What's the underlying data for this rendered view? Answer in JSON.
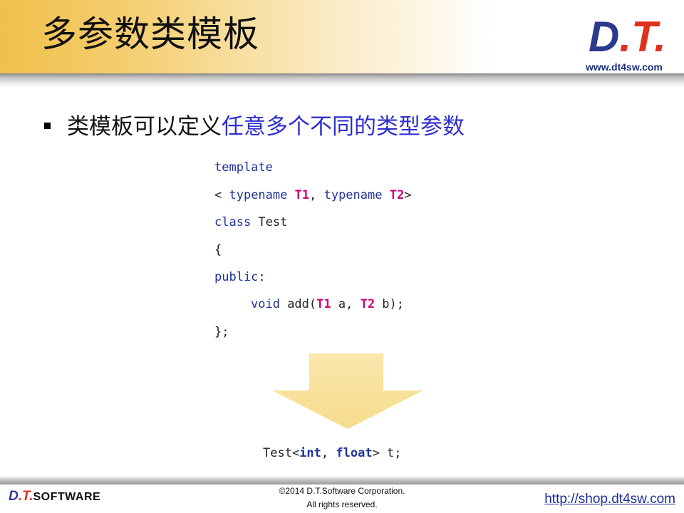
{
  "slide": {
    "title": "多参数类模板",
    "logo_prefix": "D",
    "logo_dot1": ".",
    "logo_t": "T",
    "logo_dot2": ".",
    "site_url": "www.dt4sw.com"
  },
  "bullet": {
    "text_plain": "类模板可以定义",
    "text_highlight": "任意多个不同的类型参数"
  },
  "code": {
    "line1": "template",
    "line2_a": "< ",
    "line2_kw1": "typename",
    "line2_sp1": " ",
    "line2_t1": "T1",
    "line2_comma": ", ",
    "line2_kw2": "typename",
    "line2_sp2": " ",
    "line2_t2": "T2",
    "line2_end": ">",
    "line3_kw": "class",
    "line3_rest": " Test",
    "line4": "{",
    "line5_kw": "public",
    "line5_rest": ":",
    "line6_kw": "void",
    "line6_a": " add(",
    "line6_t1": "T1",
    "line6_b": " a, ",
    "line6_t2": "T2",
    "line6_c": " b);",
    "line7": "};"
  },
  "instantiation": {
    "prefix": "Test<",
    "kw1": "int",
    "comma": ", ",
    "kw2": "float",
    "suffix": "> t;"
  },
  "arrow": {
    "color": "#fbe6a6"
  },
  "footer": {
    "logo_d": "D",
    "logo_dot1": ".",
    "logo_t": "T",
    "logo_dot2": ".",
    "logo_software": "SOFTWARE",
    "copyright": "©2014 D.T.Software Corporation.",
    "rights": "All rights reserved.",
    "shop_link": "http://shop.dt4sw.com"
  }
}
